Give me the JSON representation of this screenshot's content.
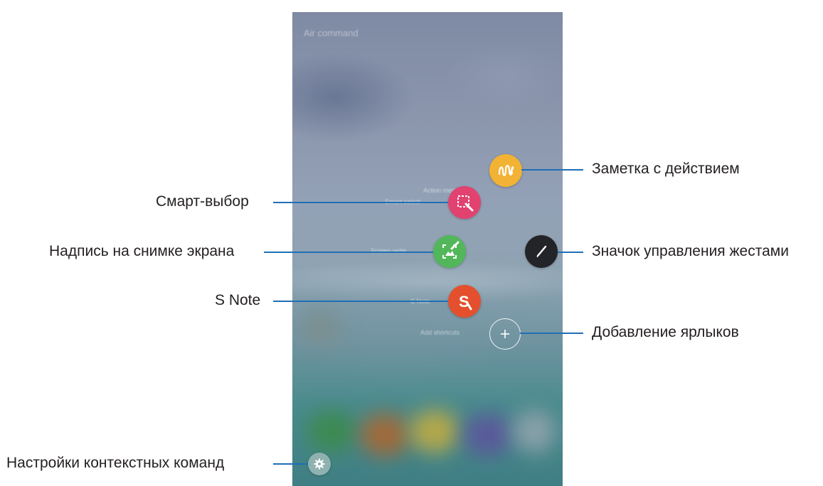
{
  "screen": {
    "title": "Air command",
    "menu": [
      {
        "key": "action_memo",
        "label": "Action memo",
        "icon": "action-memo-icon",
        "color": "#f2b233"
      },
      {
        "key": "smart_select",
        "label": "Smart select",
        "icon": "smart-select-icon",
        "color": "#e2426f"
      },
      {
        "key": "screen_write",
        "label": "Screen write",
        "icon": "screen-write-icon",
        "color": "#52b75a"
      },
      {
        "key": "s_note",
        "label": "S Note",
        "icon": "s-note-icon",
        "color": "#e4502d"
      },
      {
        "key": "add_shortcuts",
        "label": "Add shortcuts",
        "icon": "plus-icon"
      }
    ],
    "pen_icon": "pen-icon",
    "settings_icon": "gear-icon"
  },
  "callouts": {
    "action_memo": "Заметка с действием",
    "smart_select": "Смарт-выбор",
    "gesture_icon": "Значок управления жестами",
    "screen_write": "Надпись на снимке экрана",
    "s_note": "S Note",
    "add_shortcuts": "Добавление ярлыков",
    "settings": "Настройки контекстных команд"
  },
  "colors": {
    "leader_line": "#1f6fb5",
    "callout_text": "#231f20"
  }
}
